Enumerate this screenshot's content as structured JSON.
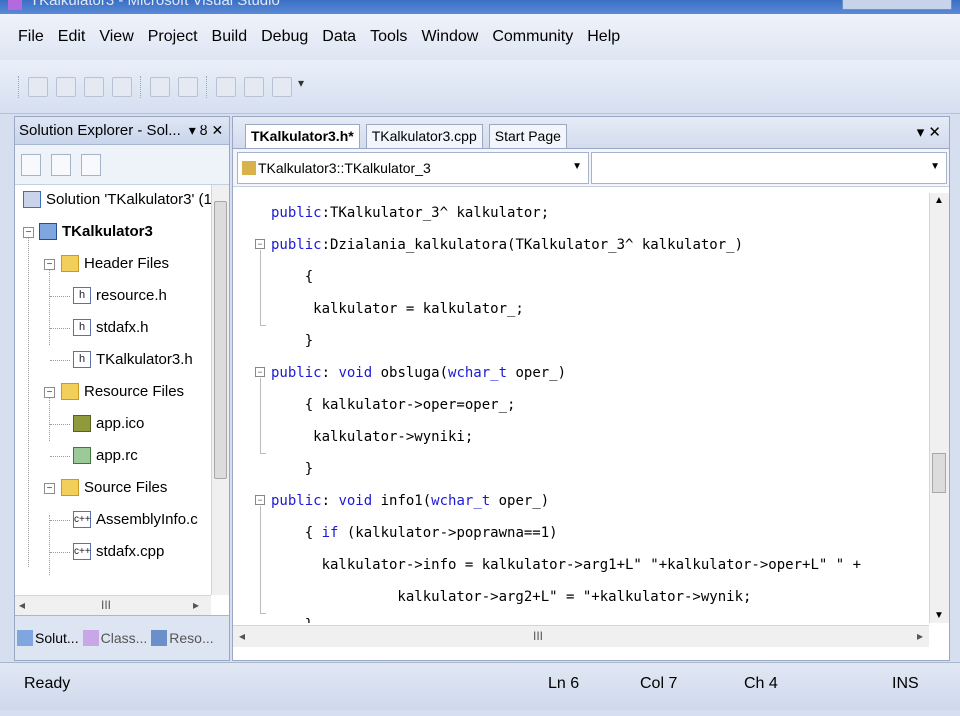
{
  "window": {
    "title": "TKalkulator3 - Microsoft Visual Studio"
  },
  "menu": [
    "File",
    "Edit",
    "View",
    "Project",
    "Build",
    "Debug",
    "Data",
    "Tools",
    "Window",
    "Community",
    "Help"
  ],
  "solution_explorer": {
    "title": "Solution Explorer - Sol...",
    "controls": "▾ ȣ ✕",
    "tree": {
      "solution": "Solution 'TKalkulator3' (1",
      "project": "TKalkulator3",
      "header_folder": "Header Files",
      "header_files": [
        "resource.h",
        "stdafx.h",
        "TKalkulator3.h"
      ],
      "resource_folder": "Resource Files",
      "resource_files": [
        "app.ico",
        "app.rc"
      ],
      "source_folder": "Source Files",
      "source_files": [
        "AssemblyInfo.c",
        "stdafx.cpp"
      ]
    },
    "bottom_tabs": [
      "Solut...",
      "Class...",
      "Reso..."
    ]
  },
  "editor": {
    "tabs": [
      "TKalkulator3.h*",
      "TKalkulator3.cpp",
      "Start Page"
    ],
    "tab_controls": "▾ ✕",
    "scope_combo": "TKalkulator3::TKalkulator_3",
    "member_combo": "",
    "hscroll_label": "III",
    "code_lines": [
      "public:TKalkulator_3^ kalkulator;",
      "public:Dzialania_kalkulatora(TKalkulator_3^ kalkulator_)",
      "    {",
      "     kalkulator = kalkulator_;",
      "    }",
      "public: void obsluga(wchar_t oper_)",
      "    { kalkulator->oper=oper_;",
      "     kalkulator->wyniki;",
      "    }",
      "public: void info1(wchar_t oper_)",
      "    { if (kalkulator->poprawna==1)",
      "      kalkulator->info = kalkulator->arg1+L\" \"+kalkulator->oper+L\" \" +",
      "               kalkulator->arg2+L\" = \"+kalkulator->wynik;",
      "    }"
    ]
  },
  "status": {
    "ready": "Ready",
    "ln": "Ln 6",
    "col": "Col 7",
    "ch": "Ch 4",
    "mode": "INS"
  },
  "colors": {
    "keyword": "#1a1ad6",
    "chrome": "#d6dff0"
  }
}
